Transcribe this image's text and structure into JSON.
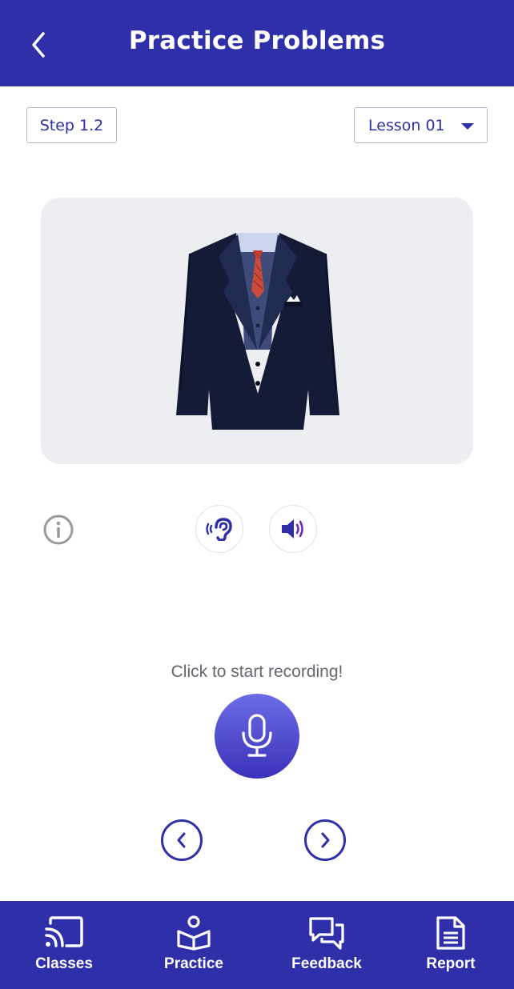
{
  "header": {
    "title": "Practice Problems",
    "back_icon": "chevron-left-icon"
  },
  "controls": {
    "step_label": "Step 1.2",
    "lesson_selected": "Lesson 01"
  },
  "image": {
    "subject": "suit-jacket"
  },
  "actions": {
    "info_icon": "info-icon",
    "listen_icon": "ear-icon",
    "speaker_icon": "speaker-icon"
  },
  "recording": {
    "prompt": "Click to start recording!",
    "mic_icon": "microphone-icon"
  },
  "nav_arrows": {
    "prev_icon": "chevron-left-circle-icon",
    "next_icon": "chevron-right-circle-icon"
  },
  "bottom_nav": {
    "items": [
      {
        "label": "Classes",
        "icon": "cast-icon"
      },
      {
        "label": "Practice",
        "icon": "book-reader-icon"
      },
      {
        "label": "Feedback",
        "icon": "chat-icon"
      },
      {
        "label": "Report",
        "icon": "document-icon"
      }
    ]
  },
  "colors": {
    "primary": "#2e2fa9",
    "card_bg": "#eceef2",
    "mic_gradient_top": "#6c6ce6",
    "mic_gradient_bottom": "#3a32ba"
  }
}
